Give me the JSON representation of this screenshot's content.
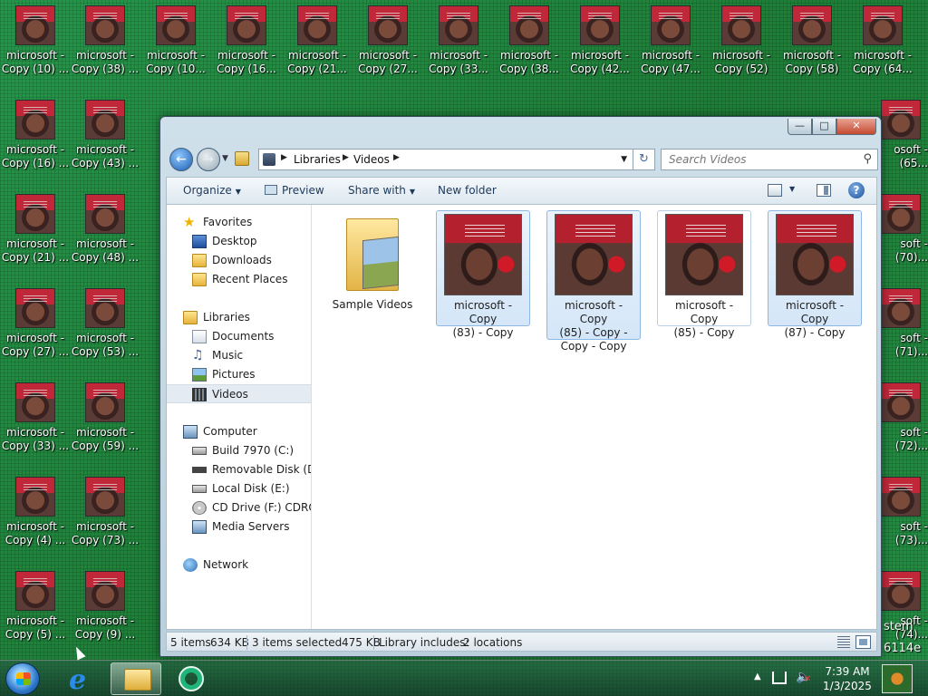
{
  "desktop": {
    "col1": [
      {
        "l1": "microsoft -",
        "l2": "Copy (10) ..."
      },
      {
        "l1": "microsoft -",
        "l2": "Copy (16) ..."
      },
      {
        "l1": "microsoft -",
        "l2": "Copy (21) ..."
      },
      {
        "l1": "microsoft -",
        "l2": "Copy (27) ..."
      },
      {
        "l1": "microsoft -",
        "l2": "Copy (33) ..."
      },
      {
        "l1": "microsoft -",
        "l2": "Copy (4) ..."
      },
      {
        "l1": "microsoft -",
        "l2": "Copy (5) ..."
      }
    ],
    "col2": [
      {
        "l1": "microsoft -",
        "l2": "Copy (38) ..."
      },
      {
        "l1": "microsoft -",
        "l2": "Copy (43) ..."
      },
      {
        "l1": "microsoft -",
        "l2": "Copy (48) ..."
      },
      {
        "l1": "microsoft -",
        "l2": "Copy (53) ..."
      },
      {
        "l1": "microsoft -",
        "l2": "Copy (59) ..."
      },
      {
        "l1": "microsoft -",
        "l2": "Copy (73) ..."
      },
      {
        "l1": "microsoft -",
        "l2": "Copy (9) ..."
      }
    ],
    "top_row": [
      {
        "l1": "microsoft -",
        "l2": "Copy (10..."
      },
      {
        "l1": "microsoft -",
        "l2": "Copy (16..."
      },
      {
        "l1": "microsoft -",
        "l2": "Copy (21..."
      },
      {
        "l1": "microsoft -",
        "l2": "Copy (27..."
      },
      {
        "l1": "microsoft -",
        "l2": "Copy (33..."
      },
      {
        "l1": "microsoft -",
        "l2": "Copy (38..."
      },
      {
        "l1": "microsoft -",
        "l2": "Copy (42..."
      },
      {
        "l1": "microsoft -",
        "l2": "Copy (47..."
      },
      {
        "l1": "microsoft -",
        "l2": "Copy (52)"
      },
      {
        "l1": "microsoft -",
        "l2": "Copy (58)"
      },
      {
        "l1": "microsoft -",
        "l2": "Copy (64..."
      }
    ],
    "right_col": [
      {
        "l1": "osoft -",
        "l2": "(65..."
      },
      {
        "l1": "soft -",
        "l2": "(70)..."
      },
      {
        "l1": "soft -",
        "l2": "(71)..."
      },
      {
        "l1": "soft -",
        "l2": "(72)..."
      },
      {
        "l1": "soft -",
        "l2": "(73)..."
      },
      {
        "l1": "soft -",
        "l2": "(74)..."
      }
    ],
    "watermark": {
      "system": "stem",
      "build": "6114e"
    }
  },
  "window": {
    "caption": {
      "minimize": "—",
      "maximize": "□",
      "close": "✕"
    },
    "address": {
      "crumbs": [
        "Libraries",
        "Videos"
      ]
    },
    "search": {
      "placeholder": "Search Videos"
    },
    "toolbar": {
      "organize": "Organize",
      "preview": "Preview",
      "share_with": "Share with",
      "new_folder": "New folder",
      "help": "?"
    },
    "nav": {
      "favorites": "Favorites",
      "desktop": "Desktop",
      "downloads": "Downloads",
      "recent_places": "Recent Places",
      "libraries": "Libraries",
      "documents": "Documents",
      "music": "Music",
      "pictures": "Pictures",
      "videos": "Videos",
      "computer": "Computer",
      "drive_c": "Build 7970 (C:)",
      "drive_d": "Removable Disk (D:)",
      "drive_e": "Local Disk (E:)",
      "drive_f": "CD Drive (F:) CDROM",
      "media_servers": "Media Servers",
      "network": "Network"
    },
    "files": [
      {
        "lines": [
          "Sample Videos"
        ]
      },
      {
        "lines": [
          "microsoft - Copy",
          "(83) - Copy"
        ]
      },
      {
        "lines": [
          "microsoft - Copy",
          "(85) - Copy -",
          "Copy - Copy"
        ]
      },
      {
        "lines": [
          "microsoft - Copy",
          "(85) - Copy"
        ]
      },
      {
        "lines": [
          "microsoft - Copy",
          "(87) - Copy"
        ]
      }
    ],
    "status": {
      "items": "5 items",
      "items_size": "634 KB",
      "selected": "3 items selected",
      "selected_size": "475 KB",
      "library_includes_label": "Library includes:",
      "library_includes_value": "2 locations"
    }
  },
  "taskbar": {
    "clock_time": "7:39 AM",
    "clock_date": "1/3/2025"
  }
}
